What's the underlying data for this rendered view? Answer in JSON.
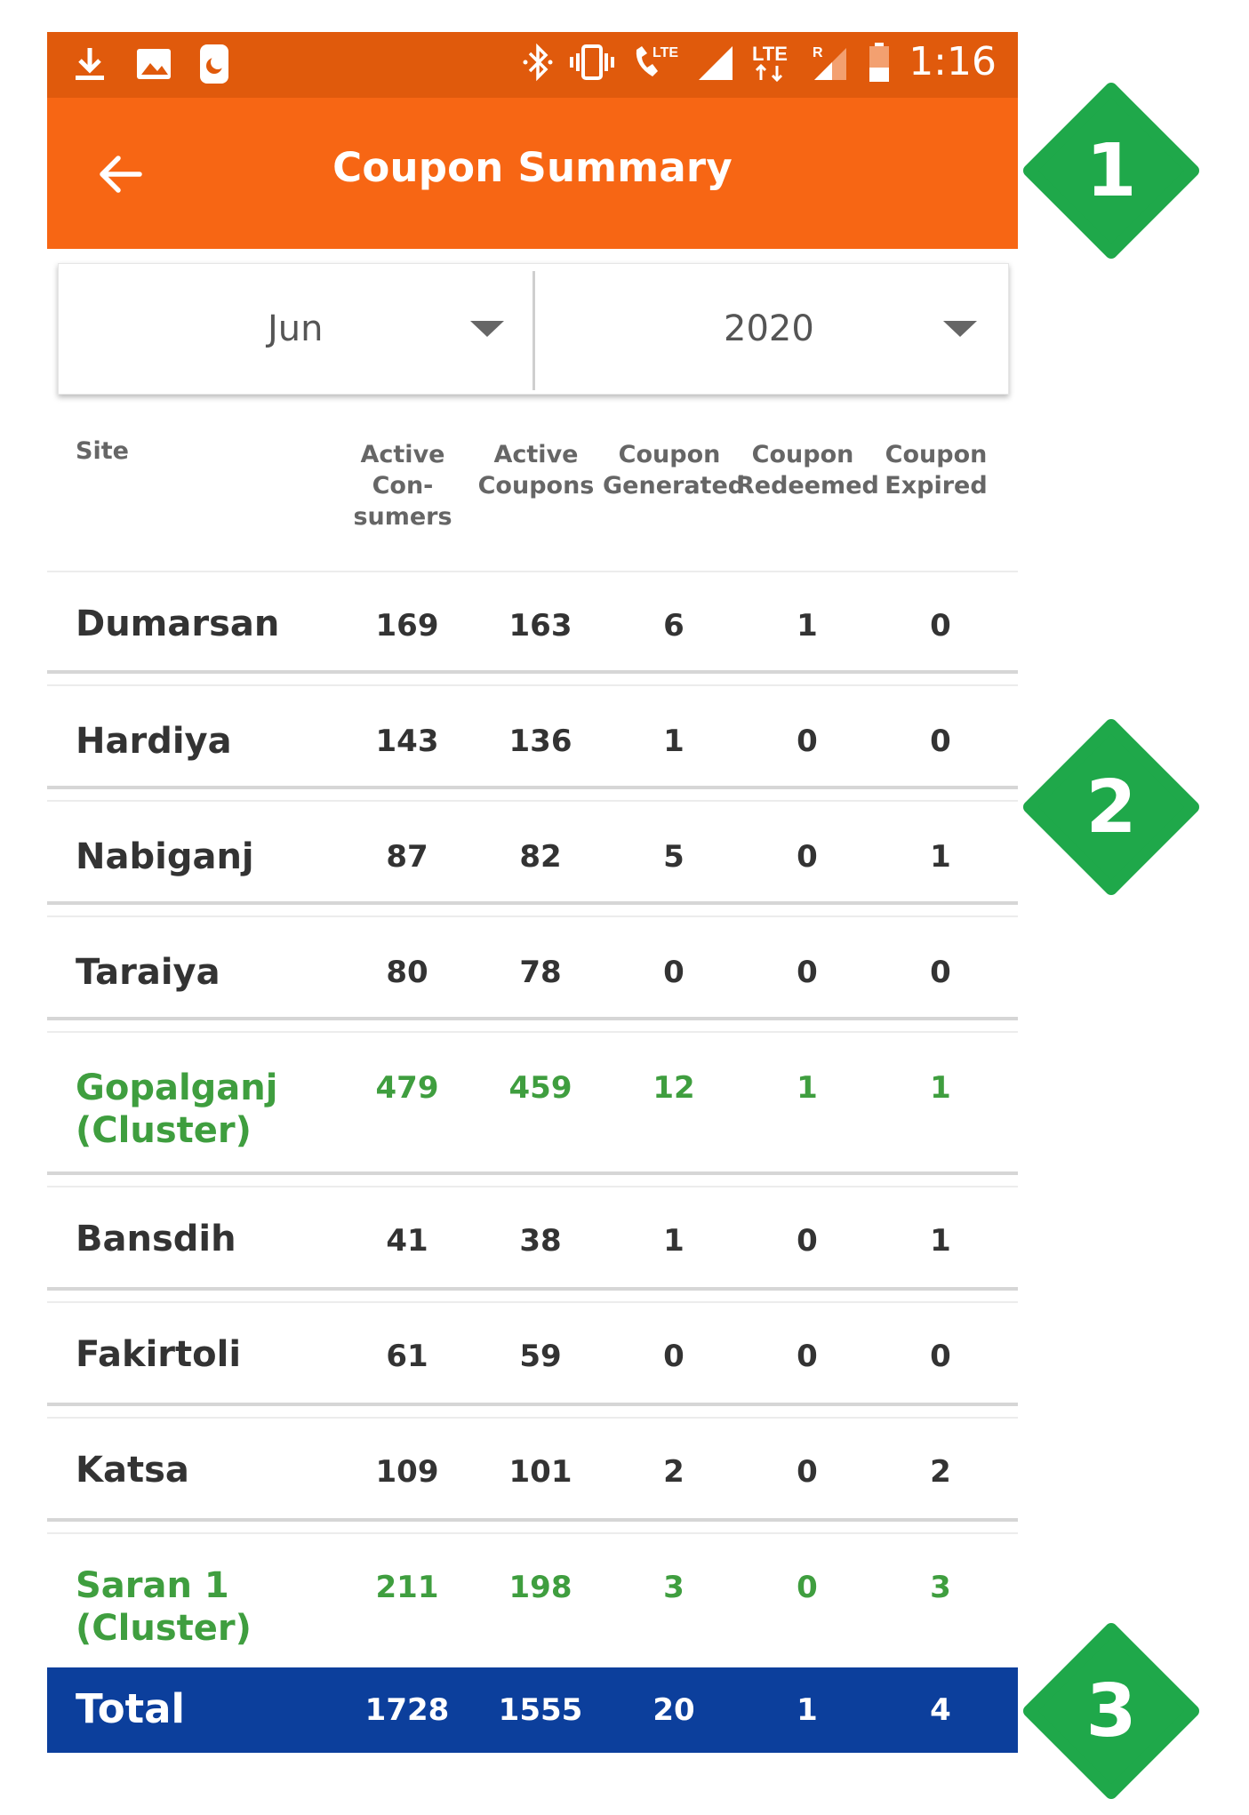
{
  "statusbar": {
    "time": "1:16",
    "left_icons": [
      "download-icon",
      "image-icon",
      "night-mode-icon"
    ],
    "right_icons": [
      "bluetooth-icon",
      "vibrate-icon",
      "lte-call-icon",
      "signal-icon",
      "lte-data-icon",
      "signal-roaming-icon",
      "battery-icon"
    ]
  },
  "appbar": {
    "title": "Coupon Summary",
    "back_icon": "arrow-left-icon"
  },
  "filters": {
    "month": "Jun",
    "year": "2020"
  },
  "table": {
    "columns": {
      "site": "Site",
      "active_consumers": [
        "Active",
        "Con-",
        "sumers"
      ],
      "active_coupons": [
        "Active",
        "Coupons"
      ],
      "coupon_generated": [
        "Coupon",
        "Generated"
      ],
      "coupon_redeemed": [
        "Coupon",
        "Redeemed"
      ],
      "coupon_expired": [
        "Coupon",
        "Expired"
      ]
    },
    "rows": [
      {
        "site": "Dumarsan",
        "v": [
          "169",
          "163",
          "6",
          "1",
          "0"
        ],
        "cluster": false
      },
      {
        "site": "Hardiya",
        "v": [
          "143",
          "136",
          "1",
          "0",
          "0"
        ],
        "cluster": false
      },
      {
        "site": "Nabiganj",
        "v": [
          "87",
          "82",
          "5",
          "0",
          "1"
        ],
        "cluster": false
      },
      {
        "site": "Taraiya",
        "v": [
          "80",
          "78",
          "0",
          "0",
          "0"
        ],
        "cluster": false
      },
      {
        "site_lines": [
          "Gopalganj",
          "(Cluster)"
        ],
        "v": [
          "479",
          "459",
          "12",
          "1",
          "1"
        ],
        "cluster": true
      },
      {
        "site": "Bansdih",
        "v": [
          "41",
          "38",
          "1",
          "0",
          "1"
        ],
        "cluster": false
      },
      {
        "site": "Fakirtoli",
        "v": [
          "61",
          "59",
          "0",
          "0",
          "0"
        ],
        "cluster": false
      },
      {
        "site": "Katsa",
        "v": [
          "109",
          "101",
          "2",
          "0",
          "2"
        ],
        "cluster": false
      },
      {
        "site_lines": [
          "Saran 1",
          "(Cluster)"
        ],
        "v": [
          "211",
          "198",
          "3",
          "0",
          "3"
        ],
        "cluster": true
      }
    ],
    "total": {
      "label": "Total",
      "v": [
        "1728",
        "1555",
        "20",
        "1",
        "4"
      ]
    }
  },
  "callouts": [
    "1",
    "2",
    "3"
  ],
  "colors": {
    "statusbar": "#e05a0c",
    "appbar": "#f76614",
    "cluster_text": "#3f9e3f",
    "total_bar": "#0c3f9c",
    "badge": "#1fa84a"
  }
}
